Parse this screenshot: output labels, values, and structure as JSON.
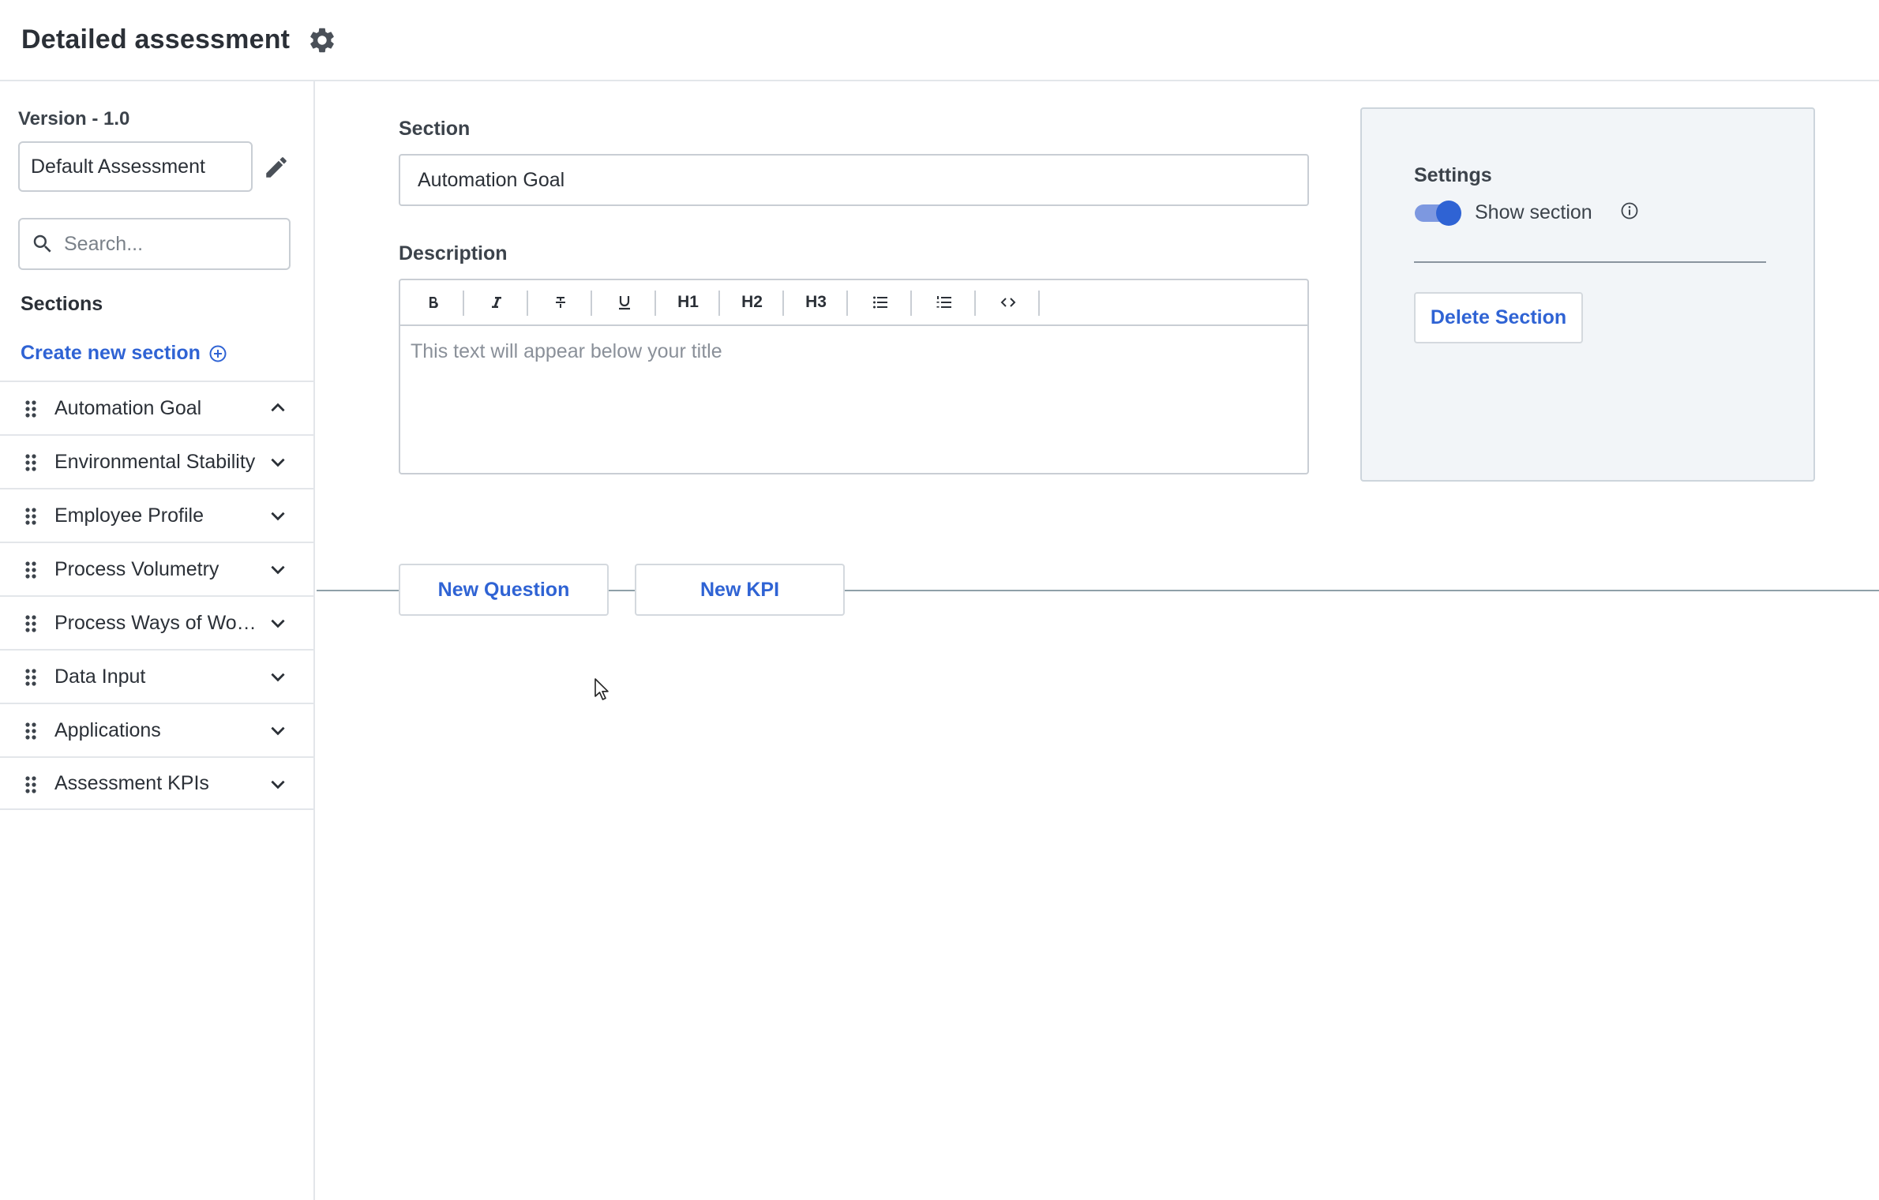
{
  "header": {
    "title": "Detailed assessment",
    "settings_icon": "gear-icon"
  },
  "sidebar": {
    "version": "Version - 1.0",
    "assessment_name": "Default Assessment",
    "search_placeholder": "Search...",
    "sections_heading": "Sections",
    "create_label": "Create new section",
    "items": [
      {
        "label": "Automation Goal",
        "expanded": true
      },
      {
        "label": "Environmental Stability",
        "expanded": false
      },
      {
        "label": "Employee Profile",
        "expanded": false
      },
      {
        "label": "Process Volumetry",
        "expanded": false
      },
      {
        "label": "Process Ways of Working",
        "expanded": false
      },
      {
        "label": "Data Input",
        "expanded": false
      },
      {
        "label": "Applications",
        "expanded": false
      },
      {
        "label": "Assessment KPIs",
        "expanded": false
      }
    ]
  },
  "main": {
    "section_label": "Section",
    "section_value": "Automation Goal",
    "description_label": "Description",
    "description_placeholder": "This text will appear below your title",
    "toolbar": {
      "h1": "H1",
      "h2": "H2",
      "h3": "H3"
    },
    "new_question_label": "New Question",
    "new_kpi_label": "New KPI"
  },
  "settings": {
    "title": "Settings",
    "show_section_label": "Show section",
    "show_section_enabled": true,
    "delete_label": "Delete Section"
  },
  "colors": {
    "accent": "#2f63d4",
    "panel_bg": "#f2f5f8",
    "border": "#c9ced4"
  }
}
